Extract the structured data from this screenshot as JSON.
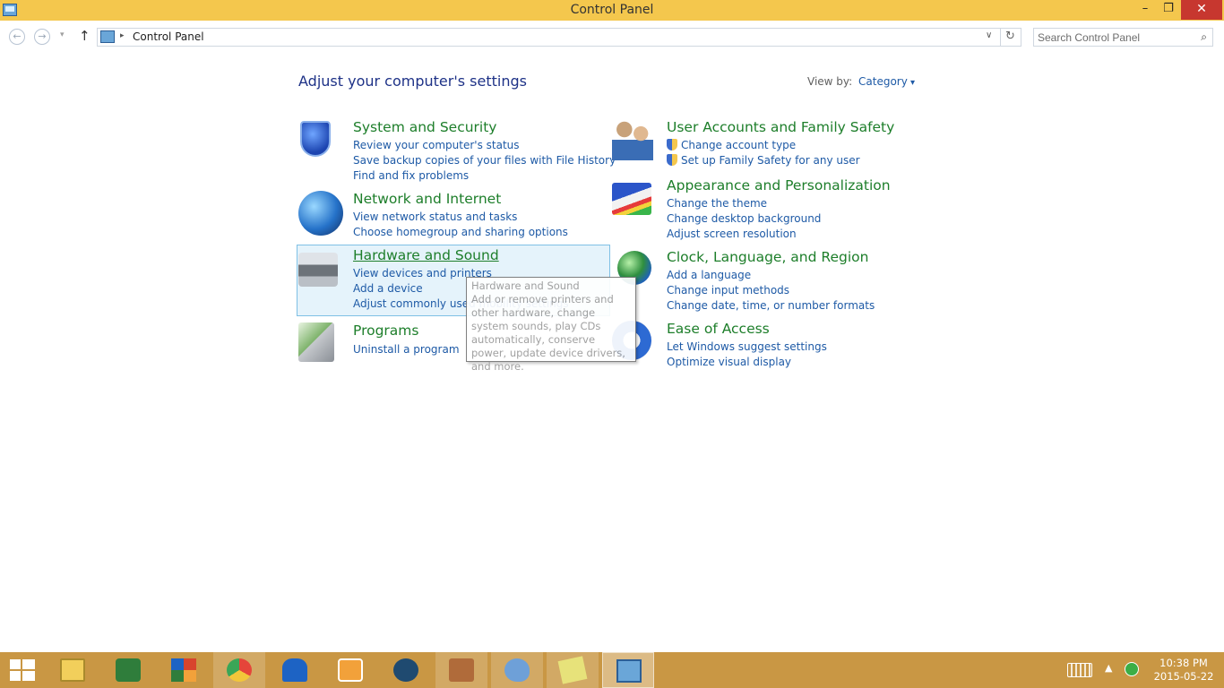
{
  "window": {
    "title": "Control Panel",
    "min_label": "–",
    "max_label": "❐",
    "close_label": "✕"
  },
  "nav": {
    "back_label": "←",
    "forward_label": "→",
    "recent_label": "▾",
    "up_label": "↑",
    "breadcrumb_sep": "▸",
    "breadcrumb": "Control Panel",
    "dropdown_label": "∨",
    "refresh_label": "↻"
  },
  "search": {
    "placeholder": "Search Control Panel",
    "value": "",
    "icon_label": "⌕"
  },
  "main": {
    "heading": "Adjust your computer's settings",
    "view_by_label": "View by:",
    "view_by_value": "Category",
    "categories": [
      {
        "title": "System and Security",
        "icon": "shield-icon",
        "links": [
          "Review your computer's status",
          "Save backup copies of your files with File History",
          "Find and fix problems"
        ]
      },
      {
        "title": "Network and Internet",
        "icon": "globe-network-icon",
        "links": [
          "View network status and tasks",
          "Choose homegroup and sharing options"
        ]
      },
      {
        "title": "Hardware and Sound",
        "icon": "printer-icon",
        "links": [
          "View devices and printers",
          "Add a device",
          "Adjust commonly used mobility settings"
        ],
        "hovered": true
      },
      {
        "title": "Programs",
        "icon": "programs-icon",
        "links": [
          "Uninstall a program"
        ]
      },
      {
        "title": "User Accounts and Family Safety",
        "icon": "users-icon",
        "links": [
          "Change account type",
          "Set up Family Safety for any user"
        ]
      },
      {
        "title": "Appearance and Personalization",
        "icon": "appearance-icon",
        "links": [
          "Change the theme",
          "Change desktop background",
          "Adjust screen resolution"
        ]
      },
      {
        "title": "Clock, Language, and Region",
        "icon": "clock-globe-icon",
        "links": [
          "Add a language",
          "Change input methods",
          "Change date, time, or number formats"
        ]
      },
      {
        "title": "Ease of Access",
        "icon": "ease-of-access-icon",
        "links": [
          "Let Windows suggest settings",
          "Optimize visual display"
        ]
      }
    ],
    "tooltip": {
      "title": "Hardware and Sound",
      "body": "Add or remove printers and other hardware, change system sounds, play CDs automatically, conserve power, update device drivers, and more."
    }
  },
  "taskbar": {
    "items": [
      {
        "name": "start-button",
        "icon": "windows-start-icon"
      },
      {
        "name": "file-explorer",
        "icon": "file-explorer-icon",
        "color": "#f2cf5b"
      },
      {
        "name": "word-app",
        "icon": "w-app-icon",
        "color": "#2f7d3b"
      },
      {
        "name": "avg-app",
        "icon": "avg-icon",
        "color": "#d8442d"
      },
      {
        "name": "chrome",
        "icon": "chrome-icon",
        "color": "#e5453a"
      },
      {
        "name": "malwarebytes",
        "icon": "malwarebytes-icon",
        "color": "#1d63c4"
      },
      {
        "name": "media-player",
        "icon": "media-player-icon",
        "color": "#f2a13a"
      },
      {
        "name": "video-editor",
        "icon": "film-icon",
        "color": "#1f4a70"
      },
      {
        "name": "app-store-like",
        "icon": "building-icon",
        "color": "#b06b3a"
      },
      {
        "name": "paint",
        "icon": "palette-icon",
        "color": "#6ea0d8"
      },
      {
        "name": "sticky-notes",
        "icon": "sticky-notes-icon",
        "color": "#e7e27a"
      },
      {
        "name": "control-panel",
        "icon": "control-panel-icon",
        "color": "#6aa6d8"
      }
    ],
    "tray_up_label": "▲",
    "time": "10:38 PM",
    "date": "2015-05-22"
  }
}
